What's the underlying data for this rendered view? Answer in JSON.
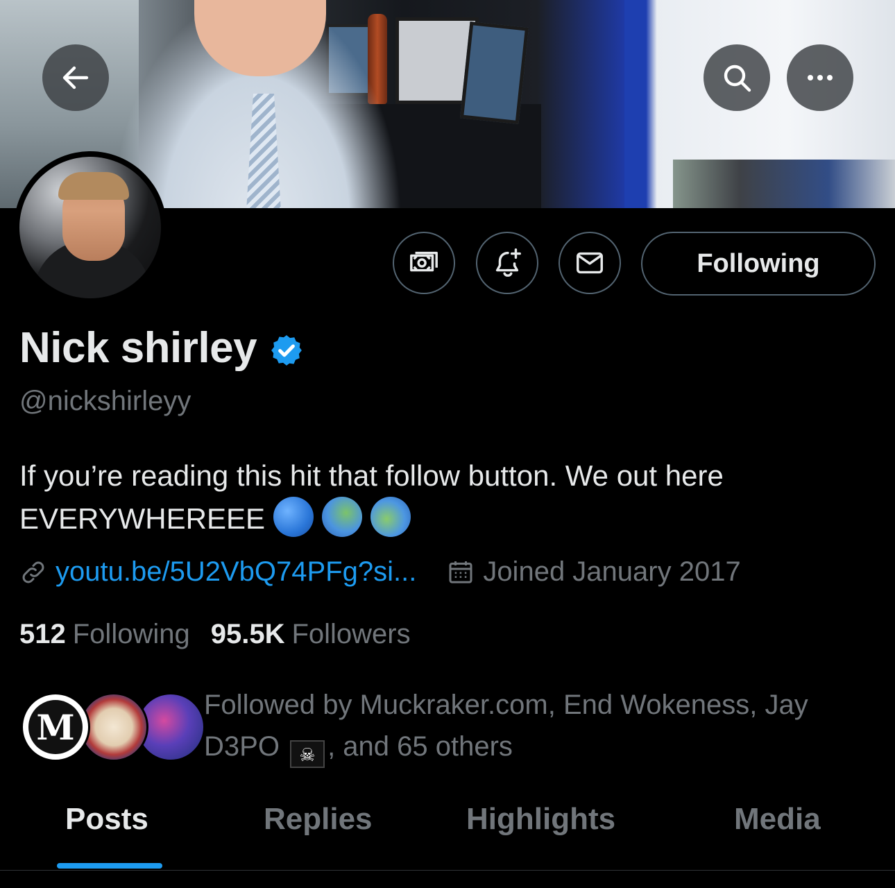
{
  "profile": {
    "display_name": "Nick shirley",
    "handle": "@nickshirleyy",
    "verified": true,
    "bio_line1": "If you’re reading this hit that follow button. We out here",
    "bio_line2": "EVERYWHEREEE",
    "bio_emojis": [
      "globe-americas",
      "globe-europe-africa",
      "globe-asia-australia"
    ],
    "link": "youtu.be/5U2VbQ74PFg?si...",
    "joined": "Joined January 2017"
  },
  "header": {
    "back_icon": "arrow-left-icon",
    "search_icon": "search-icon",
    "more_icon": "more-horizontal-icon"
  },
  "actions": {
    "subscribe_icon": "money-icon",
    "notify_icon": "bell-plus-icon",
    "message_icon": "envelope-icon",
    "following_label": "Following"
  },
  "stats": {
    "following_count": "512",
    "following_label": "Following",
    "followers_count": "95.5K",
    "followers_label": "Followers"
  },
  "followed_by": {
    "text_part1": "Followed by Muckraker.com, End Wokeness, Jay D3PO",
    "text_part2": ", and 65 others",
    "avatar1_letter": "M"
  },
  "tabs": [
    {
      "label": "Posts",
      "active": true
    },
    {
      "label": "Replies",
      "active": false
    },
    {
      "label": "Highlights",
      "active": false
    },
    {
      "label": "Media",
      "active": false
    }
  ],
  "colors": {
    "background": "#000000",
    "primary_text": "#e7e9ea",
    "secondary_text": "#71767b",
    "accent": "#1d9bf0",
    "border": "#536471"
  }
}
